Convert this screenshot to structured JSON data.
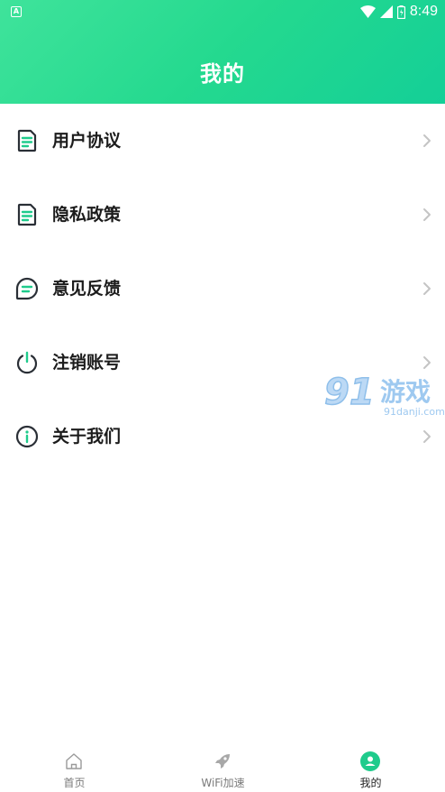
{
  "status": {
    "time": "8:49"
  },
  "header": {
    "title": "我的"
  },
  "menu": [
    {
      "label": "用户协议",
      "icon": "document-icon"
    },
    {
      "label": "隐私政策",
      "icon": "document-icon"
    },
    {
      "label": "意见反馈",
      "icon": "chat-bubble-icon"
    },
    {
      "label": "注销账号",
      "icon": "power-icon"
    },
    {
      "label": "关于我们",
      "icon": "info-icon"
    }
  ],
  "watermark": {
    "brand": "91游戏",
    "url": "91danji.com"
  },
  "tabs": [
    {
      "label": "首页",
      "icon": "home-icon",
      "active": false
    },
    {
      "label": "WiFi加速",
      "icon": "rocket-icon",
      "active": false
    },
    {
      "label": "我的",
      "icon": "user-icon",
      "active": true
    }
  ],
  "colors": {
    "accent": "#1ed38f",
    "icon_green": "#1fcb8c",
    "icon_dark": "#2a2f36"
  }
}
